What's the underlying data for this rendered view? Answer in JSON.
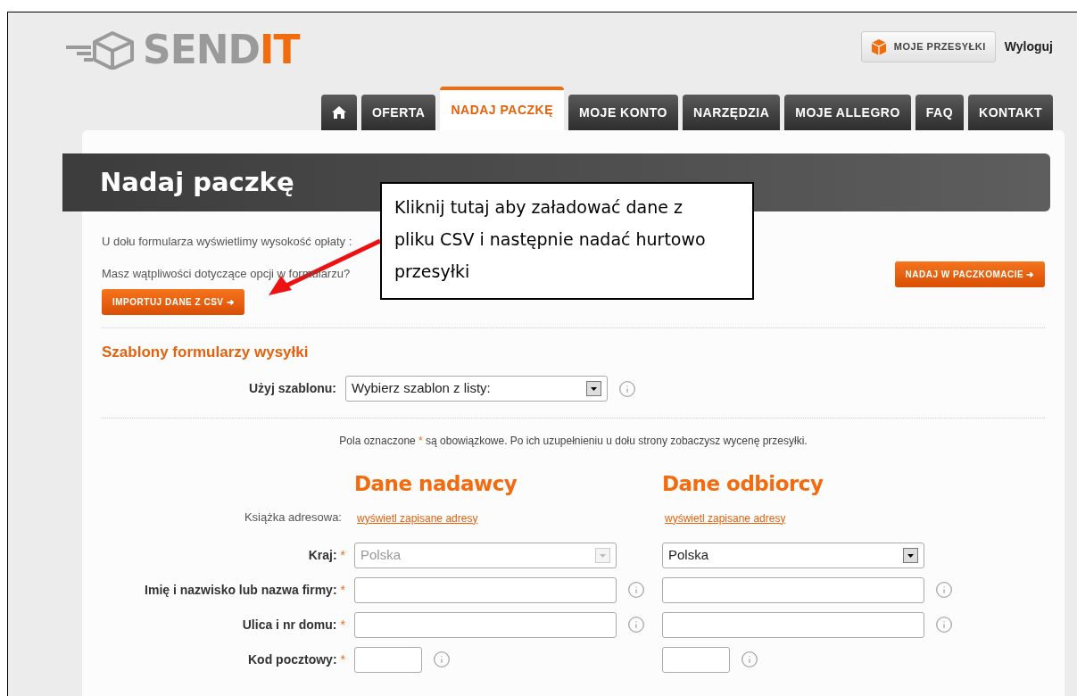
{
  "logo": {
    "text_main": "SEND",
    "text_accent": "IT"
  },
  "top_links": [
    {
      "kind": "button",
      "label": "MOJE PRZESYŁKI"
    },
    {
      "kind": "link",
      "label": "Wyloguj"
    }
  ],
  "tabs": [
    {
      "kind": "home",
      "selected": false
    },
    {
      "kind": "text",
      "label": "OFERTA",
      "selected": false
    },
    {
      "kind": "text",
      "label": "NADAJ PACZKĘ",
      "selected": true
    },
    {
      "kind": "text",
      "label": "MOJE KONTO",
      "selected": false
    },
    {
      "kind": "text",
      "label": "NARZĘDZIA",
      "selected": false
    },
    {
      "kind": "text",
      "label": "MOJE ALLEGRO",
      "selected": false
    },
    {
      "kind": "text",
      "label": "FAQ",
      "selected": false
    },
    {
      "kind": "text",
      "label": "KONTAKT",
      "selected": false
    }
  ],
  "page_title": "Nadaj paczkę",
  "intro": [
    "U dołu formularza wyświetlimy wysokość opłaty :",
    "Masz wątpliwości dotyczące opcji w formularzu?"
  ],
  "import_button": "IMPORTUJ DANE Z CSV ➜",
  "locker_button": "NADAJ W PACZKOMACIE ➜",
  "callout": "Kliknij tutaj aby załadować dane z pliku CSV i następnie nadać hurtowo przesyłki",
  "templates": {
    "heading": "Szablony formularzy wysyłki",
    "label": "Użyj szablonu:",
    "value": "Wybierz szablon z listy:",
    "info": true
  },
  "required_note": {
    "before": "Pola oznaczone",
    "mark": "*",
    "after": "są obowiązkowe. Po ich uzupełnieniu u dołu strony zobaczysz wycenę przesyłki."
  },
  "columns": [
    "Dane nadawcy",
    "Dane odbiorcy"
  ],
  "address_book": {
    "label": "Książka adresowa:",
    "links": [
      "wyświetl zapisane adresy",
      "wyświetl zapisane adresy"
    ]
  },
  "rows": [
    {
      "label": "Kraj:",
      "required": true,
      "fields": [
        {
          "kind": "select",
          "value": "Polska",
          "disabled": true
        },
        {
          "kind": "select",
          "value": "Polska",
          "disabled": false
        }
      ]
    },
    {
      "label": "Imię i nazwisko lub nazwa firmy:",
      "required": true,
      "fields": [
        {
          "kind": "input",
          "info": true
        },
        {
          "kind": "input",
          "info": true
        }
      ]
    },
    {
      "label": "Ulica i nr domu:",
      "required": true,
      "fields": [
        {
          "kind": "input",
          "info": true
        },
        {
          "kind": "input",
          "info": true
        }
      ]
    },
    {
      "label": "Kod pocztowy:",
      "required": true,
      "fields": [
        {
          "kind": "short_input",
          "info": true
        },
        {
          "kind": "short_input",
          "info": true
        }
      ]
    }
  ]
}
